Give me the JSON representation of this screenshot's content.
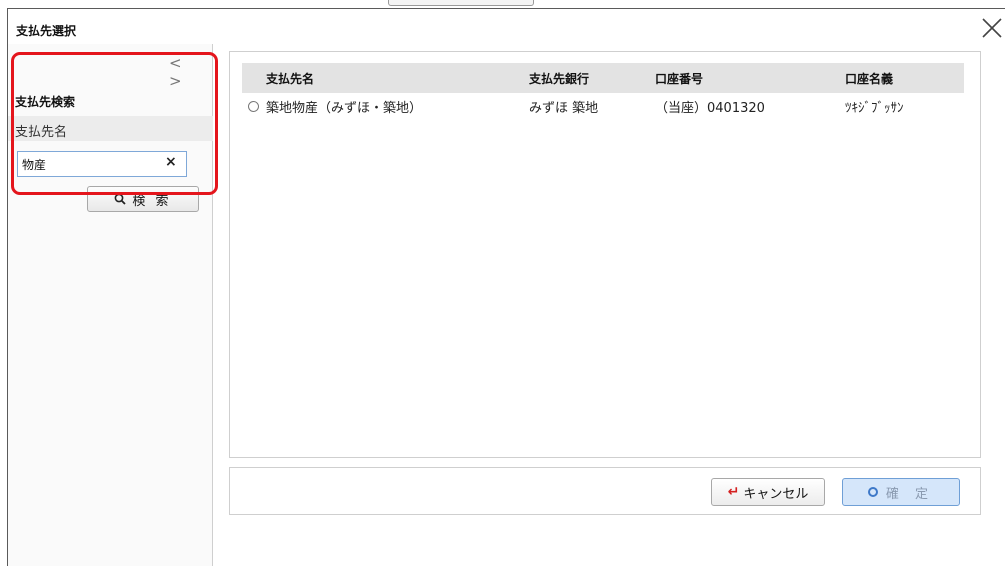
{
  "dialog": {
    "title": "支払先選択"
  },
  "nav": {
    "prev": "<",
    "next": ">"
  },
  "search_panel": {
    "heading": "支払先検索",
    "field_label": "支払先名",
    "input_value": "物産",
    "clear_icon": "×",
    "search_button_label": "検 索"
  },
  "results": {
    "columns": [
      "支払先名",
      "支払先銀行",
      "口座番号",
      "口座名義"
    ],
    "rows": [
      {
        "name": "築地物産（みずほ・築地）",
        "bank": "みずほ 築地",
        "account": "（当座）0401320",
        "holder": "ﾂｷｼﾞﾌﾞｯｻﾝ"
      }
    ]
  },
  "footer": {
    "cancel_label": "キャンセル",
    "confirm_label": "確 定"
  },
  "colors": {
    "highlight": "#e4151c",
    "confirm_bg": "#d5e6fa",
    "cancel_icon": "#d42020"
  }
}
